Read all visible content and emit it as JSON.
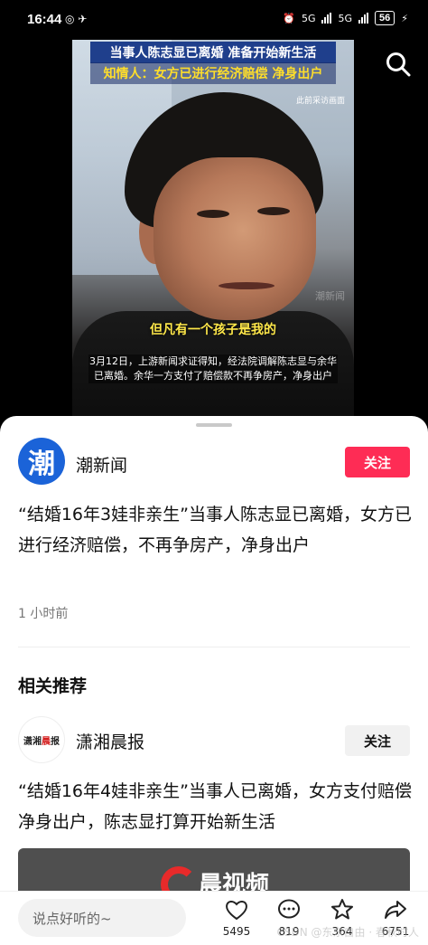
{
  "status_bar": {
    "time": "16:44",
    "left_icons": "◎ ✈",
    "network_1": "5G",
    "network_2": "5G",
    "battery": "56"
  },
  "video": {
    "headline_1": "当事人陈志显已离婚 准备开始新生活",
    "headline_2": "知情人：女方已进行经济赔偿 净身出户",
    "archive_tag": "此前采访画面",
    "watermark": "潮新闻",
    "subtitle": "但凡有一个孩子是我的",
    "caption": "3月12日，上游新闻求证得知，经法院调解陈志显与余华已离婚。余华一方支付了赔偿款不再争房产，净身出户"
  },
  "post": {
    "source_avatar_text": "潮",
    "source_name": "潮新闻",
    "follow_label": "关注",
    "title": "“结婚16年3娃非亲生”当事人陈志显已离婚，女方已进行经济赔偿，不再争房产，净身出户",
    "time_ago": "1 小时前"
  },
  "related": {
    "section_title": "相关推荐",
    "source_name": "潇湘晨报",
    "avatar_text_a": "潇湘",
    "avatar_text_b": "晨",
    "avatar_text_c": "报",
    "follow_label": "关注",
    "title": "“结婚16年4娃非亲生”当事人已离婚，女方支付赔偿净身出户，陈志显打算开始新生活",
    "thumb_text": "晨视频"
  },
  "bottom_bar": {
    "comment_placeholder": "说点好听的~",
    "like_count": "5495",
    "comment_count": "819",
    "favorite_count": "364",
    "share_count": "6751",
    "corner_watermark": "CSDN @东东自由 · 春秋时人"
  }
}
